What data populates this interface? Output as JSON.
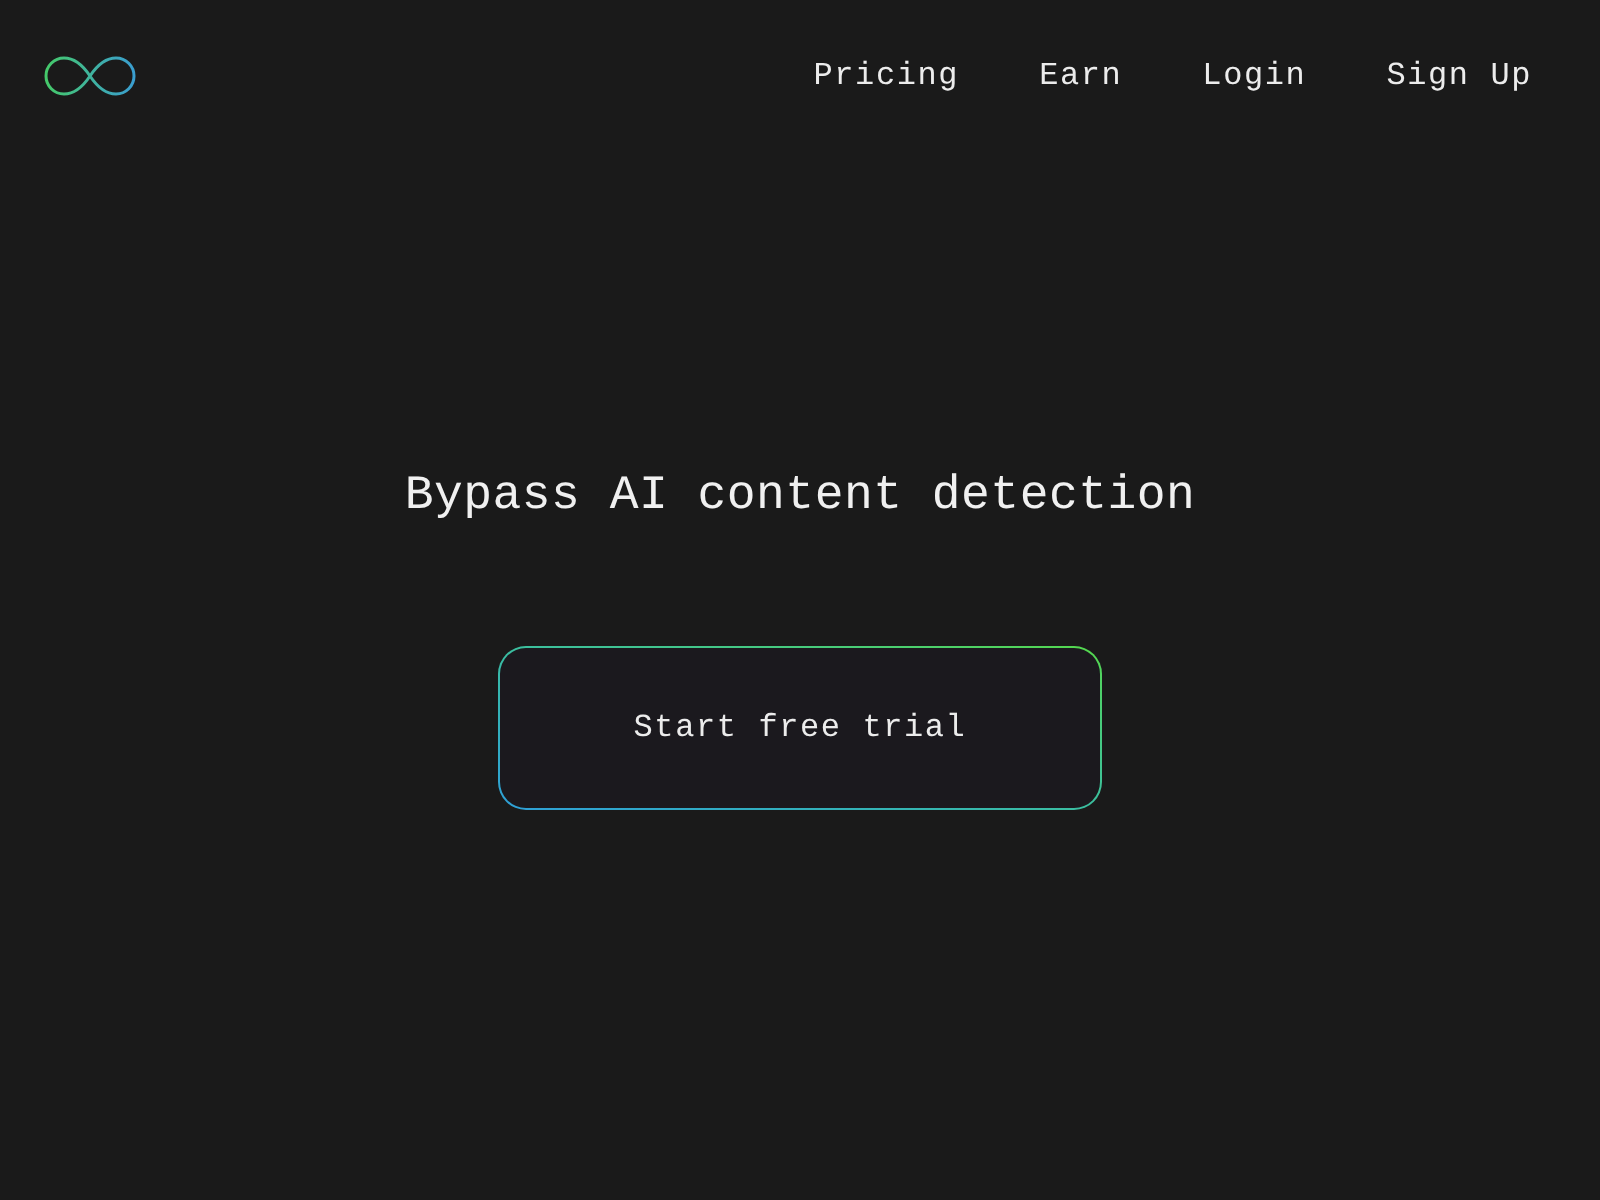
{
  "nav": [
    {
      "label": "Pricing"
    },
    {
      "label": "Earn"
    },
    {
      "label": "Login"
    },
    {
      "label": "Sign Up"
    }
  ],
  "hero": {
    "heading": "Bypass AI content detection",
    "cta": "Start free trial"
  }
}
